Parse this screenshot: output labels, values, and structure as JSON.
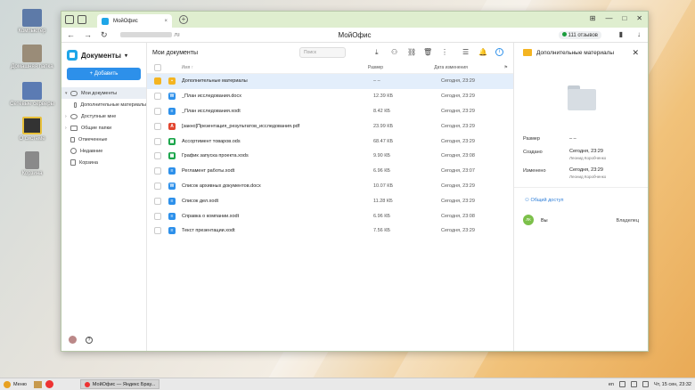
{
  "desktop": {
    "icons": [
      {
        "label": "Компьютер"
      },
      {
        "label": "Домашняя папка"
      },
      {
        "label": "Сетевые серверы"
      },
      {
        "label": "О системе"
      },
      {
        "label": "Корзина"
      }
    ]
  },
  "browser": {
    "tab_title": "МойОфис",
    "tab_close": "×",
    "new_tab": "+",
    "page_title": "МойОфис",
    "url_suffix": ".ru",
    "reviews": "111 отзывов",
    "nav": {
      "back": "←",
      "forward": "→",
      "reload": "↻",
      "download": "↓",
      "bookmark": "▮"
    },
    "window_controls": {
      "minimize": "—",
      "maximize": "□",
      "close": "✕",
      "pin": "⊞"
    }
  },
  "app": {
    "logo_label": "Документы",
    "logo_caret": "▾",
    "add_button": "+ Добавить",
    "sidebar": [
      {
        "label": "Мои документы",
        "arrow": "▾",
        "active": true,
        "sub": false
      },
      {
        "label": "Дополнительные материалы",
        "arrow": "",
        "active": false,
        "sub": true
      },
      {
        "label": "Доступные мне",
        "arrow": "›",
        "active": false,
        "sub": false
      },
      {
        "label": "Общие папки",
        "arrow": "›",
        "active": false,
        "sub": false
      },
      {
        "label": "Отмеченные",
        "arrow": "",
        "active": false,
        "sub": false
      },
      {
        "label": "Недавние",
        "arrow": "",
        "active": false,
        "sub": false
      },
      {
        "label": "Корзина",
        "arrow": "",
        "active": false,
        "sub": false
      }
    ],
    "help_icon": "?"
  },
  "main": {
    "title": "Мои документы",
    "search_placeholder": "Поиск",
    "columns": {
      "name": "Имя ↑",
      "size": "Размер",
      "date": "Дата изменения"
    },
    "rows": [
      {
        "name": "Дополнительные материалы",
        "size": "– –",
        "date": "Сегодня, 23:29",
        "type": "folder",
        "selected": true
      },
      {
        "name": "_План исследования.docx",
        "size": "12.39 КБ",
        "date": "Сегодня, 23:29",
        "type": "docx",
        "selected": false
      },
      {
        "name": "_План исследования.xodt",
        "size": "8.42 КБ",
        "date": "Сегодня, 23:29",
        "type": "xodt",
        "selected": false
      },
      {
        "name": "[закно]Презентация_результатов_исследования.pdf",
        "size": "23.99 КБ",
        "date": "Сегодня, 23:29",
        "type": "pdf",
        "selected": false
      },
      {
        "name": "Ассортимент товаров.ods",
        "size": "68.47 КБ",
        "date": "Сегодня, 23:29",
        "type": "ods",
        "selected": false
      },
      {
        "name": "График запуска проекта.xods",
        "size": "9.90 КБ",
        "date": "Сегодня, 23:08",
        "type": "xods",
        "selected": false
      },
      {
        "name": "Регламент работы.xodt",
        "size": "6.96 КБ",
        "date": "Сегодня, 23:07",
        "type": "xodt",
        "selected": false
      },
      {
        "name": "Список архивных документов.docx",
        "size": "10.07 КБ",
        "date": "Сегодня, 23:29",
        "type": "docx",
        "selected": false
      },
      {
        "name": "Список дел.xodt",
        "size": "11.28 КБ",
        "date": "Сегодня, 23:29",
        "type": "xodt",
        "selected": false
      },
      {
        "name": "Справка о компании.xodt",
        "size": "6.96 КБ",
        "date": "Сегодня, 23:08",
        "type": "xodt",
        "selected": false
      },
      {
        "name": "Текст презентации.xodt",
        "size": "7.56 КБ",
        "date": "Сегодня, 23:29",
        "type": "xodt",
        "selected": false
      }
    ]
  },
  "panel": {
    "title": "Дополнительные материалы",
    "close": "✕",
    "size_label": "Размер",
    "size_value": "– –",
    "created_label": "Создано",
    "created_value": "Сегодня, 23:29",
    "created_by": "Леонид Коробченко",
    "modified_label": "Изменено",
    "modified_value": "Сегодня, 23:29",
    "modified_by": "Леонид Коробченко",
    "share_header": "Общий доступ",
    "share_user_initials": "ЛК",
    "share_user_name": "Вы",
    "share_user_role": "Владелец"
  },
  "taskbar": {
    "menu": "Меню",
    "task": "МойОфис — Яндекс Брау...",
    "lang": "en",
    "clock": "Чт, 15 сен, 23:32"
  }
}
